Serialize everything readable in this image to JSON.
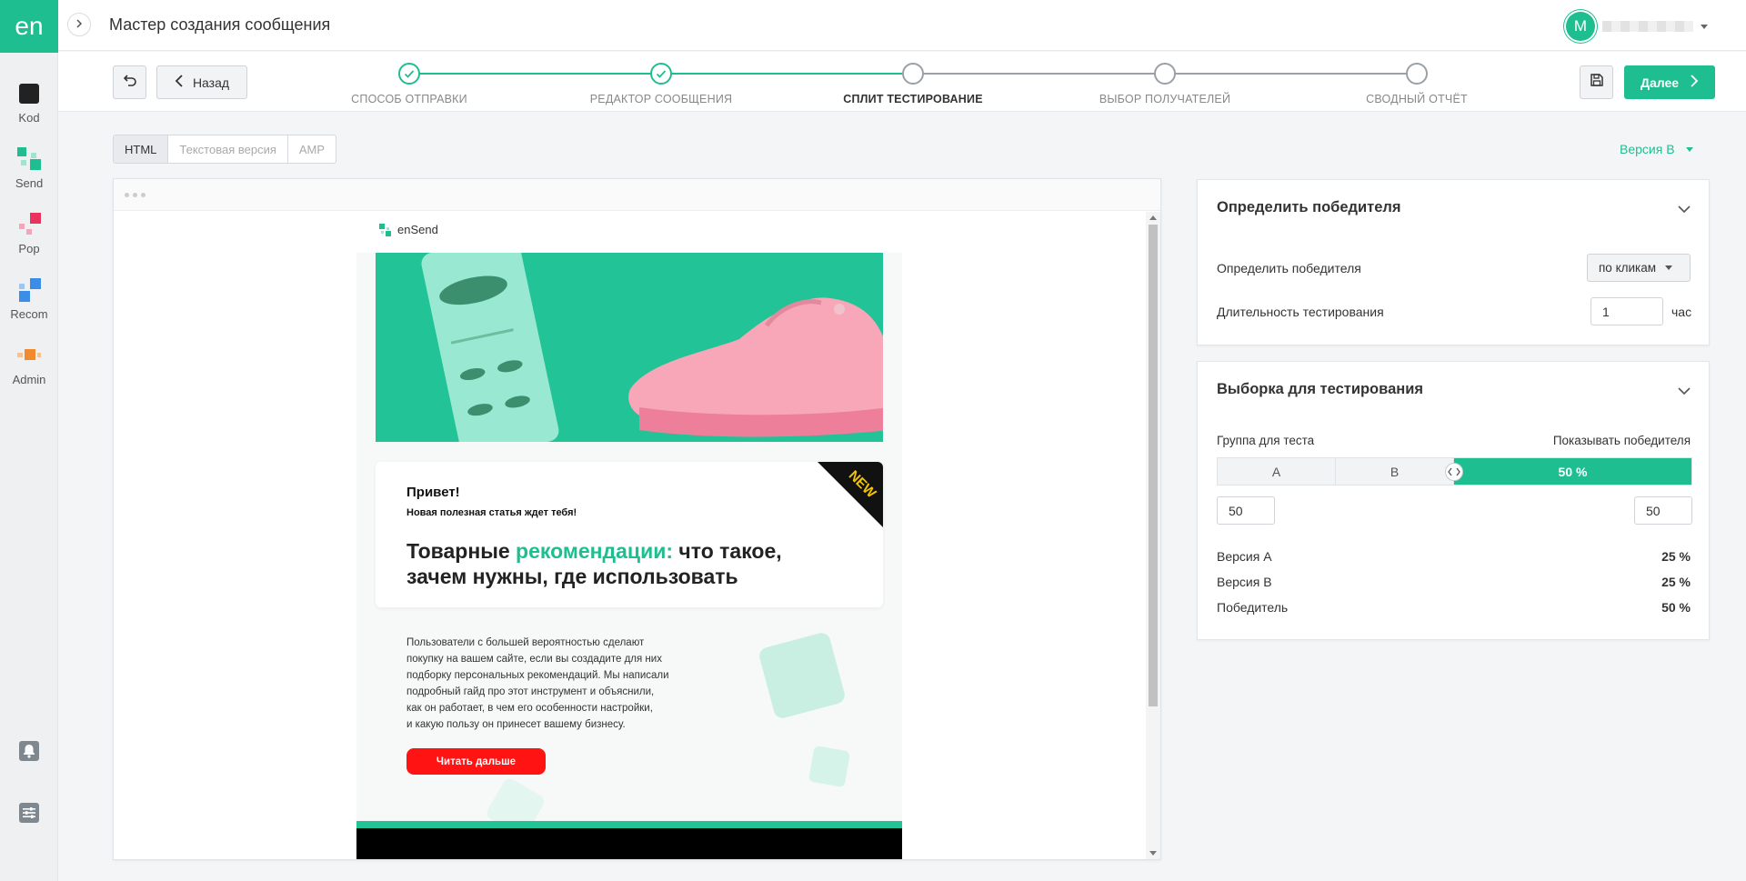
{
  "app": {
    "logo_text": "en",
    "page_title": "Мастер создания сообщения",
    "user_initial": "M"
  },
  "leftnav": {
    "items": [
      {
        "label": "Kod",
        "icon": "kod-icon"
      },
      {
        "label": "Send",
        "icon": "send-icon"
      },
      {
        "label": "Pop",
        "icon": "pop-icon"
      },
      {
        "label": "Recom",
        "icon": "recom-icon"
      },
      {
        "label": "Admin",
        "icon": "admin-icon"
      }
    ]
  },
  "wizard": {
    "back_label": "Назад",
    "next_label": "Далее",
    "steps": [
      {
        "label": "СПОСОБ ОТПРАВКИ",
        "state": "done"
      },
      {
        "label": "РЕДАКТОР СООБЩЕНИЯ",
        "state": "done"
      },
      {
        "label": "СПЛИТ ТЕСТИРОВАНИЕ",
        "state": "active"
      },
      {
        "label": "ВЫБОР ПОЛУЧАТЕЛЕЙ",
        "state": "todo"
      },
      {
        "label": "СВОДНЫЙ ОТЧЁТ",
        "state": "todo"
      }
    ]
  },
  "tabs": [
    {
      "label": "HTML",
      "active": true
    },
    {
      "label": "Текстовая версия",
      "active": false
    },
    {
      "label": "AMP",
      "active": false
    }
  ],
  "version_selector": "Версия B",
  "email": {
    "brand": "enSend",
    "ribbon": "NEW",
    "greeting": "Привет!",
    "subtitle": "Новая полезная статья ждет тебя!",
    "headline_a": "Товарные ",
    "headline_accent": "рекомендации:",
    "headline_b": " что такое, зачем нужны, где использовать",
    "body_lines": [
      "Пользователи с большей вероятностью сделают",
      "покупку на вашем сайте, если вы создадите для них",
      "подборку персональных рекомендаций. Мы написали",
      "подробный гайд про этот инструмент и объяснили,",
      "как он работает, в чем его особенности настройки,",
      "и какую пользу он принесет вашему бизнесу."
    ],
    "cta": "Читать дальше"
  },
  "winner_panel": {
    "title": "Определить победителя",
    "criterion_label": "Определить победителя",
    "criterion_value": "по кликам",
    "duration_label": "Длительность тестирования",
    "duration_value": "1",
    "duration_unit": "час"
  },
  "sample_panel": {
    "title": "Выборка для тестирования",
    "group_label": "Группа для теста",
    "show_winner_label": "Показывать победителя",
    "segments": {
      "a": "A",
      "b": "B",
      "winner": "50 %"
    },
    "winner_share": 0.5,
    "left_value": "50",
    "right_value": "50",
    "summary": [
      {
        "label": "Версия A",
        "value": "25 %"
      },
      {
        "label": "Версия B",
        "value": "25 %"
      },
      {
        "label": "Победитель",
        "value": "50 %"
      }
    ]
  },
  "colors": {
    "brand": "#1fbe91",
    "cta_red": "#ff1313"
  }
}
